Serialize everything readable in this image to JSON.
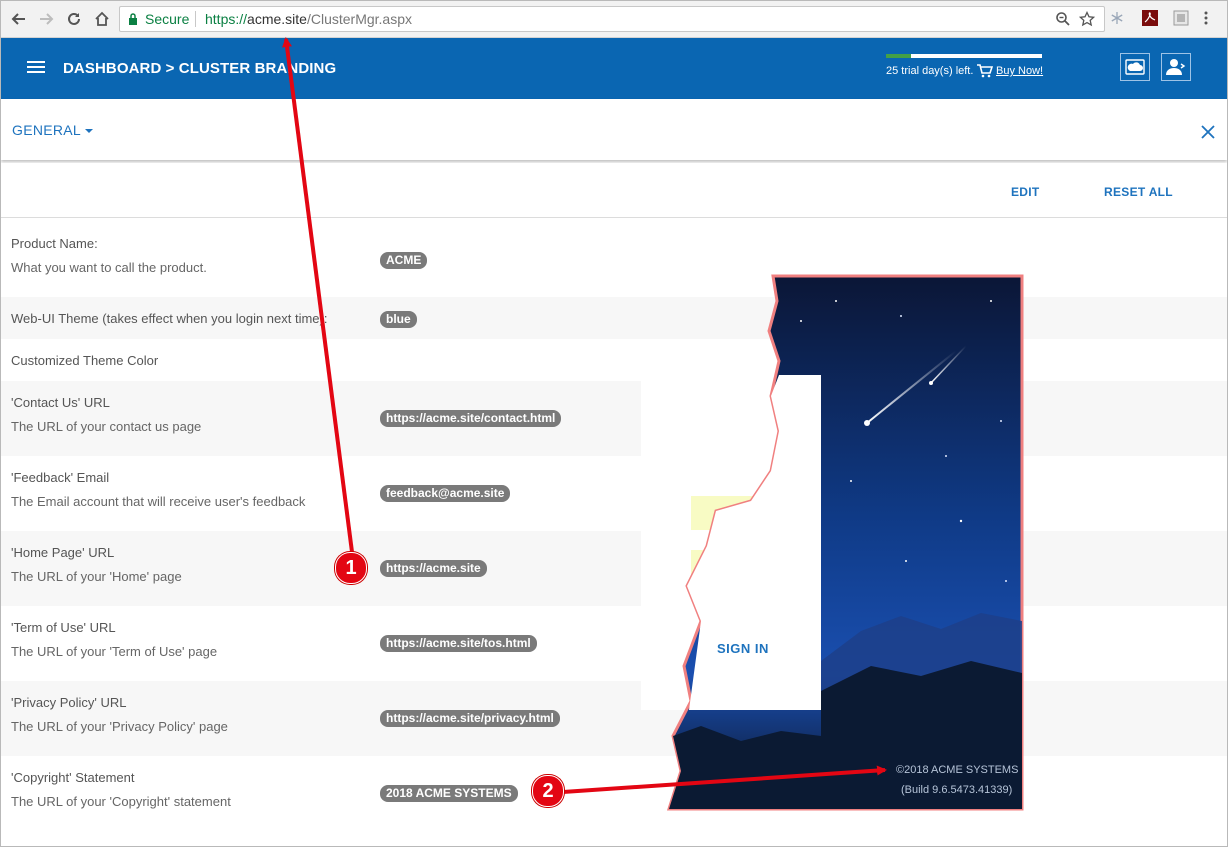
{
  "browser": {
    "secure_label": "Secure",
    "url_scheme": "https://",
    "url_host": "acme.site",
    "url_path": "/ClusterMgr.aspx",
    "nav_icons": [
      "back-icon",
      "forward-icon",
      "reload-icon",
      "home-icon"
    ],
    "right_icons": [
      "zoom-icon",
      "star-icon",
      "snowflake-icon",
      "pdf-icon",
      "page-icon"
    ]
  },
  "header": {
    "breadcrumb": "DASHBOARD > CLUSTER BRANDING",
    "trial_text": "25 trial day(s) left.",
    "trial_progress": 0.16,
    "buy_now": "Buy Now!",
    "accent": "#0a66b2"
  },
  "toolbar": {
    "general_label": "GENERAL",
    "edit_label": "EDIT",
    "reset_label": "RESET ALL"
  },
  "settings": [
    {
      "label": "Product Name:",
      "description": "What you want to call the product.",
      "value": "ACME"
    },
    {
      "label": "Web-UI Theme (takes effect when you login next time):",
      "description": "",
      "value": "blue"
    },
    {
      "label": "Customized Theme Color",
      "description": "",
      "value": ""
    },
    {
      "label": "'Contact Us' URL",
      "description": "The URL of your contact us page",
      "value": "https://acme.site/contact.html"
    },
    {
      "label": "'Feedback' Email",
      "description": "The Email account that will receive user's feedback",
      "value": "feedback@acme.site"
    },
    {
      "label": "'Home Page' URL",
      "description": "The URL of your 'Home' page",
      "value": "https://acme.site"
    },
    {
      "label": "'Term of Use' URL",
      "description": "The URL of your 'Term of Use' page",
      "value": "https://acme.site/tos.html"
    },
    {
      "label": "'Privacy Policy' URL",
      "description": "The URL of your 'Privacy Policy' page",
      "value": "https://acme.site/privacy.html"
    },
    {
      "label": "'Copyright' Statement",
      "description": "The URL of your 'Copyright' statement",
      "value": "2018 ACME SYSTEMS"
    }
  ],
  "preview": {
    "signin_label": "SIGN IN",
    "copyright": "©2018 ACME SYSTEMS",
    "build": "(Build 9.6.5473.41339)"
  },
  "annotations": {
    "marker_1": "1",
    "marker_2": "2",
    "arrow_color": "#e30613"
  }
}
